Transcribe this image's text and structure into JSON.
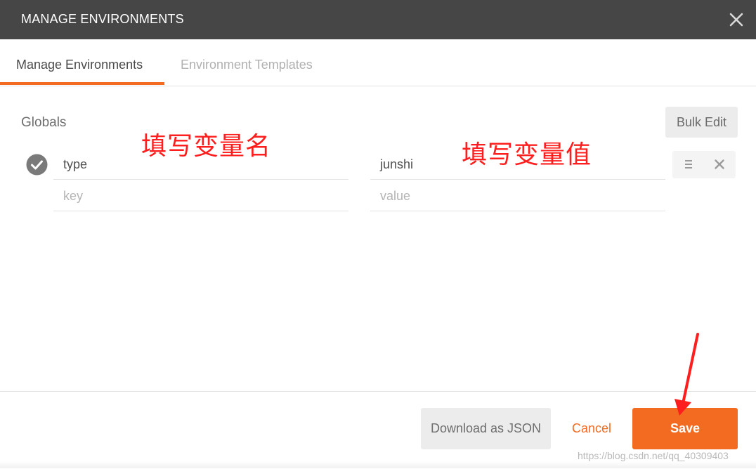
{
  "window": {
    "title": "MANAGE ENVIRONMENTS",
    "close_icon": "close-icon"
  },
  "tabs": [
    {
      "label": "Manage Environments",
      "active": true
    },
    {
      "label": "Environment Templates",
      "active": false
    }
  ],
  "globals": {
    "label": "Globals",
    "bulk_edit_label": "Bulk Edit",
    "rows": [
      {
        "key": "type",
        "value": "junshi",
        "enabled": true
      },
      {
        "key_placeholder": "key",
        "value_placeholder": "value"
      }
    ]
  },
  "annotations": {
    "name_hint": "填写变量名",
    "value_hint": "填写变量值"
  },
  "footer": {
    "download_label": "Download as JSON",
    "cancel_label": "Cancel",
    "save_label": "Save"
  },
  "watermark": "https://blog.csdn.net/qq_40309403",
  "colors": {
    "accent": "#f26b21",
    "titlebar": "#464646",
    "annotation": "#ff1e1e"
  }
}
